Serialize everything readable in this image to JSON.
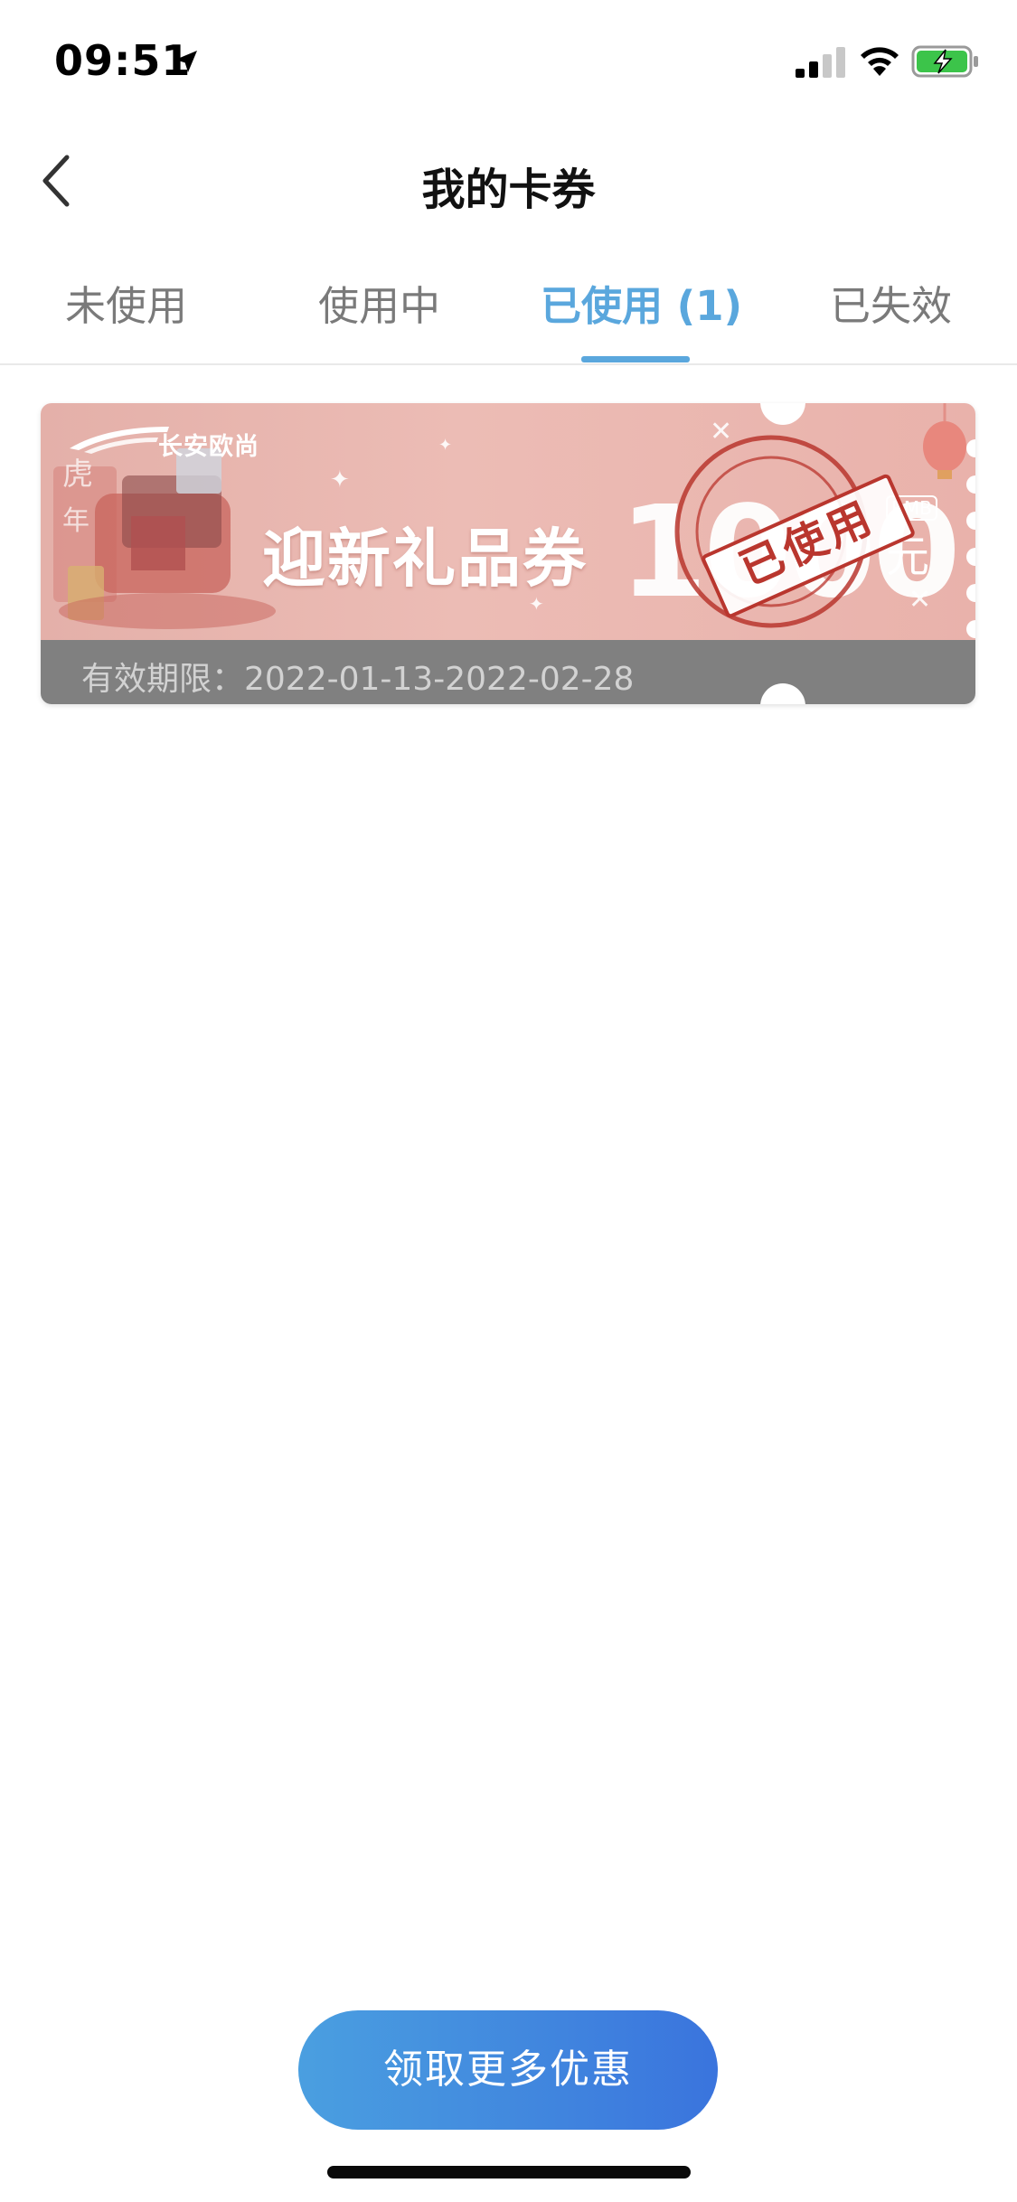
{
  "status_bar": {
    "time": "09:51",
    "icons": [
      "location-arrow-icon",
      "cellular-signal-icon",
      "wifi-icon",
      "battery-charging-icon"
    ]
  },
  "nav": {
    "title": "我的卡券",
    "back_icon": "chevron-left-icon"
  },
  "tabs": [
    {
      "label": "未使用",
      "active": false
    },
    {
      "label": "使用中",
      "active": false
    },
    {
      "label": "已使用 (1)",
      "active": true
    },
    {
      "label": "已失效",
      "active": false
    }
  ],
  "coupon": {
    "brand": "长安欧尚",
    "name": "迎新礼品券",
    "amount": "1000",
    "currency_badge": "RMB",
    "unit": "元",
    "stamp": "已使用",
    "validity": "有效期限：2022-01-13-2022-02-28"
  },
  "cta": {
    "label": "领取更多优惠"
  },
  "colors": {
    "accent": "#5aa7dd",
    "button_start": "#4a9fe0",
    "button_end": "#3a74dd",
    "stamp_red": "#b9362e",
    "coupon_bg": "#e8b5ae"
  }
}
